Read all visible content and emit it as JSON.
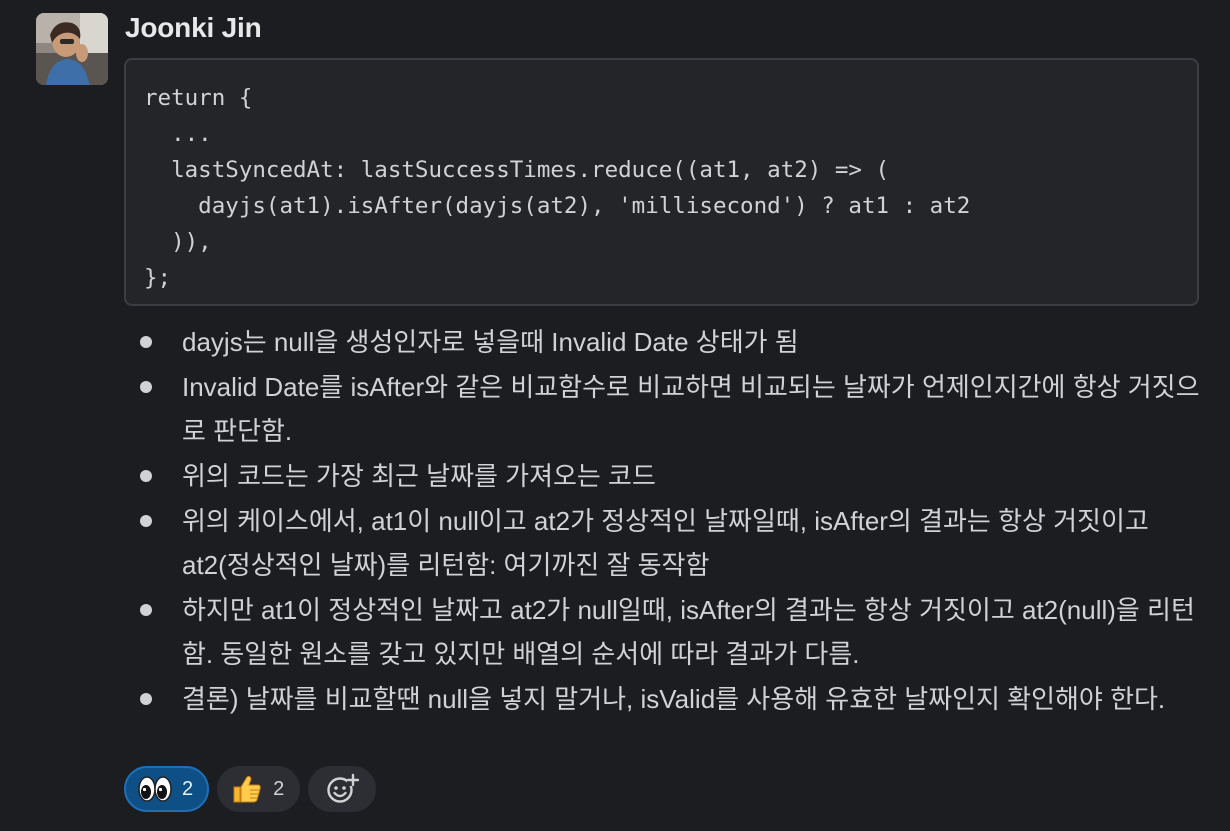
{
  "message": {
    "author": "Joonki Jin",
    "code": "return {\n  ...\n  lastSyncedAt: lastSuccessTimes.reduce((at1, at2) => (\n    dayjs(at1).isAfter(dayjs(at2), 'millisecond') ? at1 : at2\n  )),\n};",
    "bullets": [
      "dayjs는 null을 생성인자로 넣을때 Invalid Date 상태가 됨",
      "Invalid Date를 isAfter와 같은 비교함수로 비교하면 비교되는 날짜가 언제인지간에 항상 거짓으로 판단함.",
      "위의 코드는 가장 최근 날짜를 가져오는 코드",
      "위의 케이스에서, at1이 null이고 at2가 정상적인 날짜일때, isAfter의 결과는 항상 거짓이고 at2(정상적인 날짜)를 리턴함: 여기까진 잘 동작함",
      "하지만 at1이 정상적인 날짜고 at2가 null일때, isAfter의 결과는 항상 거짓이고 at2(null)을 리턴함. 동일한 원소를 갖고 있지만 배열의 순서에 따라 결과가 다름.",
      "결론) 날짜를 비교할땐 null을 넣지 말거나, isValid를 사용해 유효한 날짜인지 확인해야 한다."
    ]
  },
  "reactions": [
    {
      "emoji": "eyes-icon",
      "count": "2",
      "active": true
    },
    {
      "emoji": "thumbs-up-icon",
      "count": "2",
      "active": false
    }
  ],
  "add_reaction_icon": "add-reaction-icon",
  "colors": {
    "background": "#1b1d21",
    "code_background": "#232529",
    "active_reaction": "#0e4f86"
  }
}
